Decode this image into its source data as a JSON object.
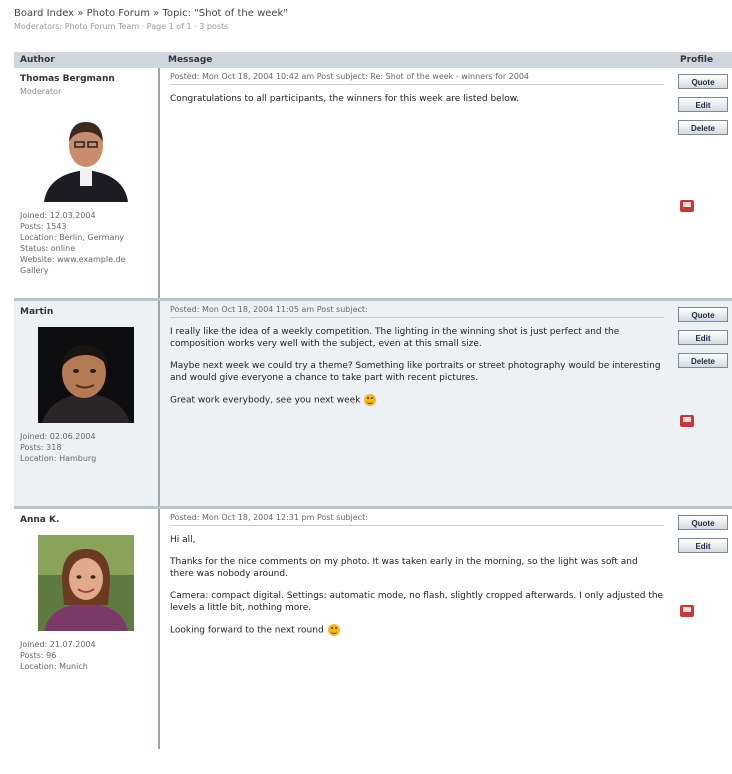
{
  "header": {
    "breadcrumb": "Board Index » Photo Forum » Topic: \"Shot of the week\"",
    "subline": "Moderators: Photo Forum Team · Page 1 of 1 · 3 posts"
  },
  "table_headers": {
    "author": "Author",
    "message": "Message",
    "actions": "Profile"
  },
  "buttons": {
    "quote": "Quote",
    "edit": "Edit",
    "delete": "Delete"
  },
  "posts": [
    {
      "author": "Thomas Bergmann",
      "role": "Moderator",
      "meta": [
        "Joined: 12.03.2004",
        "Posts: 1543",
        "Location: Berlin, Germany",
        "Status: online"
      ],
      "meta2": [
        "Website: www.example.de",
        "Gallery"
      ],
      "date": "Posted: Mon Oct 18, 2004 10:42 am    Post subject: Re: Shot of the week - winners for 2004",
      "paragraphs": [
        "Congratulations to all participants, the winners for this week are listed below."
      ]
    },
    {
      "author": "Martin",
      "role": "",
      "meta": [
        "Joined: 02.06.2004",
        "Posts: 318",
        "Location: Hamburg"
      ],
      "date": "Posted: Mon Oct 18, 2004 11:05 am    Post subject:",
      "paragraphs": [
        "I really like the idea of a weekly competition. The lighting in the winning shot is just perfect and the composition works very well with the subject, even at this small size.",
        "Maybe next week we could try a theme? Something like portraits or street photography would be interesting and would give everyone a chance to take part with recent pictures.",
        "Great work everybody, see you next week"
      ]
    },
    {
      "author": "Anna K.",
      "role": "",
      "meta": [
        "Joined: 21.07.2004",
        "Posts: 96",
        "Location: Munich"
      ],
      "date": "Posted: Mon Oct 18, 2004 12:31 pm    Post subject:",
      "paragraphs": [
        "Hi all,",
        "Thanks for the nice comments on my photo. It was taken early in the morning, so the light was soft and there was nobody around.",
        "Camera: compact digital. Settings: automatic mode, no flash, slightly cropped afterwards. I only adjusted the levels a little bit, nothing more.",
        "Looking forward to the next round"
      ]
    }
  ]
}
